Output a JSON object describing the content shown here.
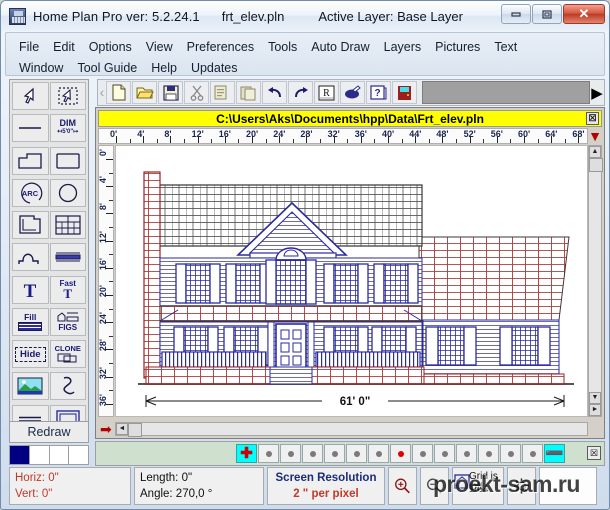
{
  "window": {
    "title": "Home Plan Pro ver: 5.2.24.1",
    "file": "frt_elev.pln",
    "active_layer": "Active Layer: Base Layer",
    "minimize_label": "–",
    "maximize_label": "□",
    "close_label": "✕",
    "app_icon": "house-app-icon"
  },
  "menu": {
    "row1": [
      "File",
      "Edit",
      "Options",
      "View",
      "Preferences",
      "Tools",
      "Auto Draw",
      "Layers",
      "Pictures",
      "Text"
    ],
    "row2": [
      "Window",
      "Tool Guide",
      "Help",
      "Updates"
    ]
  },
  "toolbar": {
    "buttons": [
      {
        "name": "new-file-icon",
        "label": "New"
      },
      {
        "name": "open-folder-icon",
        "label": "Open"
      },
      {
        "name": "save-disk-icon",
        "label": "Save"
      },
      {
        "name": "cut-scissors-icon",
        "label": "Cut"
      },
      {
        "name": "copy-icon",
        "label": "Copy"
      },
      {
        "name": "paste-icon",
        "label": "Paste"
      },
      {
        "name": "undo-arrow-icon",
        "label": "Undo"
      },
      {
        "name": "redo-arrow-icon",
        "label": "Redo"
      },
      {
        "name": "ruler-r-icon",
        "label": "R"
      },
      {
        "name": "print-icon",
        "label": "Print"
      },
      {
        "name": "help-question-icon",
        "label": "Help"
      },
      {
        "name": "exit-door-icon",
        "label": "Exit"
      }
    ],
    "expand_arrow": "▶"
  },
  "palette": {
    "tools": [
      {
        "name": "select-arrow-tool",
        "label": ""
      },
      {
        "name": "select-area-tool",
        "label": ""
      },
      {
        "name": "line-tool",
        "label": ""
      },
      {
        "name": "dimension-tool",
        "label": "DIM"
      },
      {
        "name": "polygon-tool",
        "label": ""
      },
      {
        "name": "rectangle-tool",
        "label": ""
      },
      {
        "name": "arc-tool",
        "label": "ARC"
      },
      {
        "name": "circle-tool",
        "label": ""
      },
      {
        "name": "wall-tool",
        "label": ""
      },
      {
        "name": "window-grid-tool",
        "label": ""
      },
      {
        "name": "curve-tool",
        "label": ""
      },
      {
        "name": "beam-tool",
        "label": ""
      },
      {
        "name": "text-tool",
        "label": "T"
      },
      {
        "name": "fast-text-tool",
        "label": "Fast T"
      },
      {
        "name": "fill-tool",
        "label": "Fill"
      },
      {
        "name": "figs-tool",
        "label": "FIGS"
      },
      {
        "name": "hide-tool",
        "label": "Hide"
      },
      {
        "name": "clone-tool",
        "label": "CLONE"
      },
      {
        "name": "picture-tool",
        "label": ""
      },
      {
        "name": "freehand-tool",
        "label": ""
      },
      {
        "name": "double-line-tool",
        "label": ""
      },
      {
        "name": "box-tool",
        "label": ""
      }
    ],
    "redraw_label": "Redraw",
    "swatch_colors": [
      "#000080",
      "#ffffff",
      "#ffffff",
      "#ffffff"
    ]
  },
  "document": {
    "path_title": "C:\\Users\\Aks\\Documents\\hpp\\Data\\Frt_elev.pln",
    "close_label": "☒",
    "h_ruler_labels": [
      "0'",
      "4'",
      "8'",
      "12'",
      "16'",
      "20'",
      "24'",
      "28'",
      "32'",
      "36'",
      "40'",
      "44'",
      "48'",
      "52'",
      "56'",
      "60'",
      "64'",
      "68'"
    ],
    "v_ruler_labels": [
      "0'",
      "4'",
      "8'",
      "12'",
      "16'",
      "20'",
      "24'",
      "28'",
      "32'",
      "36'"
    ],
    "drawing_name": "front-elevation-drawing",
    "dimension_label": "61' 0\"",
    "scroll": {
      "up": "▲",
      "down": "▼",
      "left": "◄",
      "right": "►"
    }
  },
  "layerbar": {
    "add_label": "✚",
    "remove_label": "➖",
    "close_label": "☒",
    "layers": [
      {
        "name": "layer-1",
        "active": false
      },
      {
        "name": "layer-2",
        "active": false
      },
      {
        "name": "layer-3",
        "active": false
      },
      {
        "name": "layer-4",
        "active": false
      },
      {
        "name": "layer-5",
        "active": false
      },
      {
        "name": "layer-6",
        "active": false
      },
      {
        "name": "layer-7",
        "active": true
      },
      {
        "name": "layer-8",
        "active": false
      },
      {
        "name": "layer-9",
        "active": false
      },
      {
        "name": "layer-10",
        "active": false
      },
      {
        "name": "layer-11",
        "active": false
      },
      {
        "name": "layer-12",
        "active": false
      },
      {
        "name": "layer-13",
        "active": false
      }
    ]
  },
  "status": {
    "horiz": "Horiz: 0\"",
    "vert": "Vert: 0\"",
    "length": "Length:  0\"",
    "angle": "Angle:  270,0 °",
    "resolution_line1": "Screen Resolution",
    "resolution_line2": "2 \" per pixel",
    "zoom_in": "zoom-in-icon",
    "zoom_out": "zoom-out-icon",
    "fit_icon": "fit-page-icon",
    "grid_text": "Grid is Off",
    "grid_fraction": "1/64",
    "settings_icon": "gear-icon"
  },
  "watermark": {
    "text": "proekt-sam.ru"
  },
  "colors": {
    "doc_title_bg": "#ffff00",
    "accent_cyan": "#00ffff",
    "status_red": "#c0392b",
    "brick_red": "#9c1f1f",
    "navy": "#191970"
  }
}
